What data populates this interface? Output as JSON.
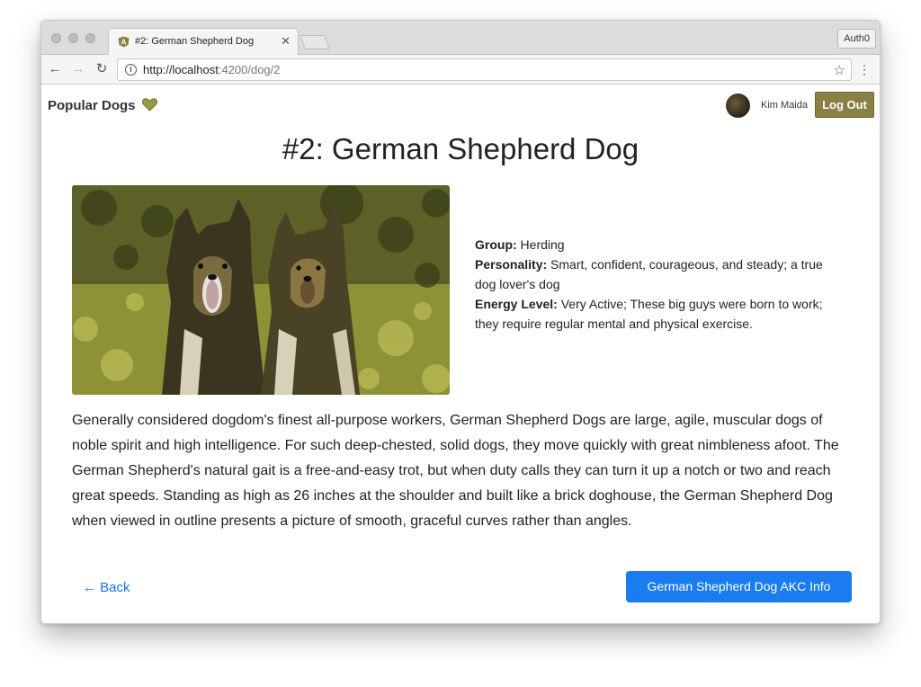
{
  "browser": {
    "tab_title": "#2: German Shepherd Dog",
    "tab_close": "✕",
    "extension_label": "Auth0",
    "url_host": "http://localhost",
    "url_path": ":4200/dog/2"
  },
  "nav": {
    "back_glyph": "←",
    "forward_glyph": "→",
    "reload_glyph": "↻",
    "star_glyph": "☆",
    "menu_glyph": "⋮"
  },
  "header": {
    "brand": "Popular Dogs",
    "user_name": "Kim Maida",
    "logout_label": "Log Out"
  },
  "dog": {
    "title": "#2: German Shepherd Dog",
    "group_label": "Group:",
    "group_value": "Herding",
    "personality_label": "Personality:",
    "personality_value": "Smart, confident, courageous, and steady; a true dog lover's dog",
    "energy_label": "Energy Level:",
    "energy_value": "Very Active; These big guys were born to work; they require regular mental and physical exercise.",
    "description": "Generally considered dogdom's finest all-purpose workers, German Shepherd Dogs are large, agile, muscular dogs of noble spirit and high intelligence. For such deep-chested, solid dogs, they move quickly with great nimbleness afoot. The German Shepherd's natural gait is a free-and-easy trot, but when duty calls they can turn it up a notch or two and reach great speeds. Standing as high as 26 inches at the shoulder and built like a brick doghouse, the German Shepherd Dog when viewed in outline presents a picture of smooth, graceful curves rather than angles."
  },
  "actions": {
    "back_label": "← Back",
    "akc_button_label": "German Shepherd Dog AKC Info"
  },
  "colors": {
    "accent_blue": "#1a7cf0",
    "logout_olive": "#8a7f45"
  }
}
